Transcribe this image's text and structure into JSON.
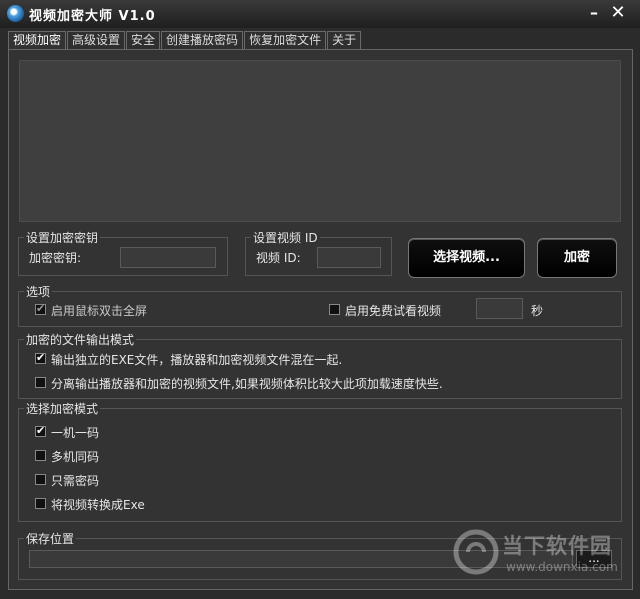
{
  "window": {
    "title": "视频加密大师 V1.0",
    "minimize": "–",
    "close": "✕"
  },
  "tabs": [
    {
      "label": "视频加密"
    },
    {
      "label": "高级设置"
    },
    {
      "label": "安全"
    },
    {
      "label": "创建播放密码"
    },
    {
      "label": "恢复加密文件"
    },
    {
      "label": "关于"
    }
  ],
  "key_group": {
    "legend": "设置加密密钥",
    "label": "加密密钥:",
    "value": ""
  },
  "id_group": {
    "legend": "设置视频 ID",
    "label": "视频 ID:",
    "value": ""
  },
  "buttons": {
    "select_video": "选择视频...",
    "encrypt": "加密",
    "browse": "..."
  },
  "options": {
    "legend": "选项",
    "fullscreen": {
      "label": "启用鼠标双击全屏",
      "checked": true,
      "disabled": true
    },
    "trial": {
      "label": "启用免费试看视频",
      "checked": false,
      "seconds_value": "",
      "seconds_unit": "秒"
    }
  },
  "output_mode": {
    "legend": "加密的文件输出模式",
    "items": [
      {
        "label": "输出独立的EXE文件，播放器和加密视频文件混在一起.",
        "checked": true
      },
      {
        "label": "分离输出播放器和加密的视频文件,如果视频体积比较大此项加载速度快些.",
        "checked": false
      }
    ]
  },
  "encrypt_mode": {
    "legend": "选择加密模式",
    "items": [
      {
        "label": "一机一码",
        "checked": true
      },
      {
        "label": "多机同码",
        "checked": false
      },
      {
        "label": "只需密码",
        "checked": false
      },
      {
        "label": "将视频转换成Exe",
        "checked": false
      }
    ]
  },
  "save": {
    "legend": "保存位置",
    "path": ""
  },
  "watermark": {
    "brand": "当下软件园",
    "url": "www.downxia.com"
  },
  "colors": {
    "background": "#333333",
    "button_bg": "#000000",
    "accent": "#4ea3e6"
  }
}
